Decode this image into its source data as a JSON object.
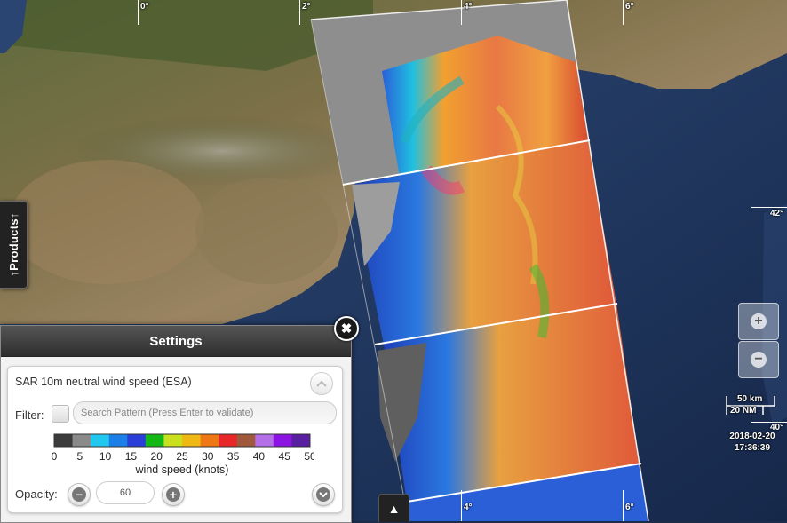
{
  "graticule": {
    "top_labels": [
      "0°",
      "2°",
      "4°",
      "6°"
    ],
    "bottom_labels": [
      "4°",
      "6°"
    ],
    "right_labels": [
      "42°",
      "40°"
    ]
  },
  "products_tab": {
    "label": "↑Products↑"
  },
  "settings": {
    "title": "Settings",
    "close_icon": "✖",
    "layer_title": "SAR 10m neutral wind speed (ESA)",
    "collapse_icon": "chevron-up-icon",
    "filter_label": "Filter:",
    "filter_placeholder": "Search Pattern (Press Enter to validate)",
    "colorbar": {
      "ticks": [
        "0",
        "5",
        "10",
        "15",
        "20",
        "25",
        "30",
        "35",
        "40",
        "45",
        "50"
      ],
      "label": "wind speed (knots)",
      "colors": [
        "#3b3b3b",
        "#8a8a8a",
        "#20c8f0",
        "#1a7fe6",
        "#2a3fd8",
        "#14b814",
        "#c8e01e",
        "#f0b814",
        "#f07814",
        "#e82828",
        "#a0583c",
        "#b46ee6",
        "#8c14e0",
        "#5a1ea0"
      ]
    },
    "opacity_label": "Opacity:",
    "opacity_value": "60",
    "minus_icon": "−",
    "plus_icon": "+"
  },
  "zoom": {
    "in_icon": "+",
    "out_icon": "−"
  },
  "scale": {
    "km": "50 km",
    "nm": "20 NM"
  },
  "timestamp": {
    "date": "2018-02-20",
    "time": "17:36:39"
  },
  "timeline_button": {
    "icon": "▲"
  }
}
